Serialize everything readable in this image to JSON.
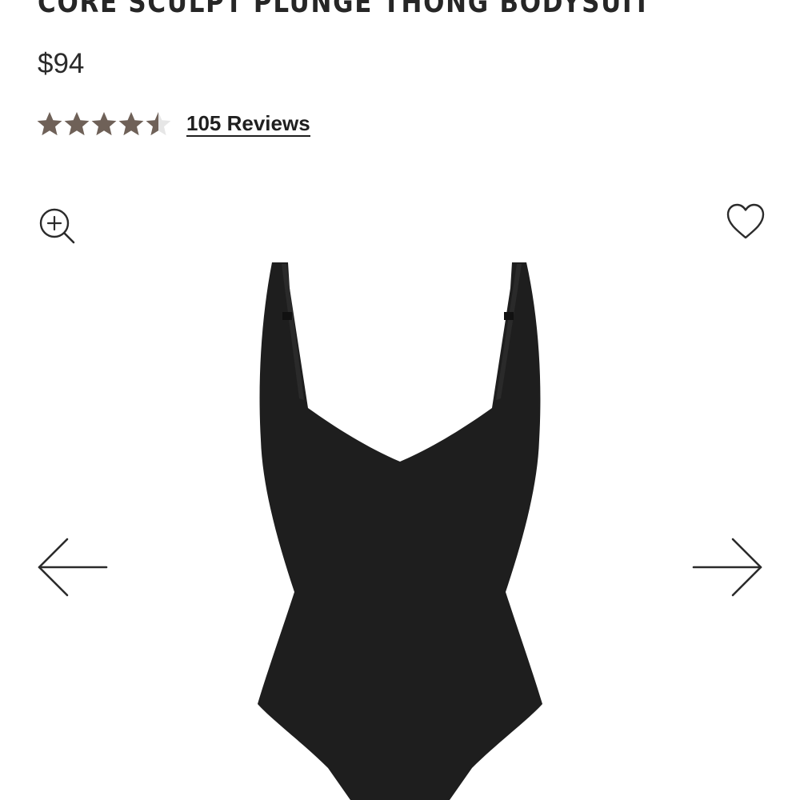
{
  "product": {
    "title": "CORE SCULPT PLUNGE THONG BODYSUIT",
    "price": "$94",
    "rating": 4.5,
    "rating_max": 5,
    "reviews_label": "105 Reviews"
  },
  "icons": {
    "zoom": "zoom-in-icon",
    "wishlist": "heart-outline-icon",
    "prev": "arrow-left-icon",
    "next": "arrow-right-icon"
  },
  "colors": {
    "star_filled": "#6f6158",
    "star_empty": "#e6e6e6",
    "text": "#2b2b2b",
    "garment": "#1e1e1e"
  }
}
